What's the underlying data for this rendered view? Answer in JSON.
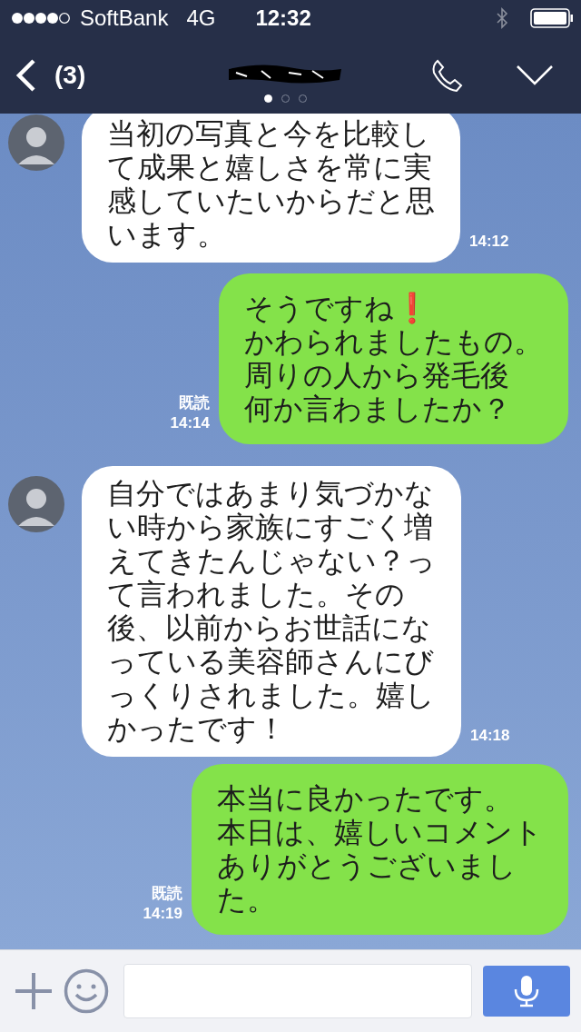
{
  "status_bar": {
    "carrier": "SoftBank",
    "network": "4G",
    "time": "12:32"
  },
  "nav": {
    "unread": "(3)",
    "pages": [
      {
        "selected": true
      },
      {
        "selected": false
      },
      {
        "selected": false
      }
    ]
  },
  "messages": [
    {
      "kind": "received",
      "lines": [
        "当初の写真と今を比較し",
        "て成果と嬉しさを常に実",
        "感していたいからだと思",
        "います。"
      ],
      "time": "14:12"
    },
    {
      "kind": "sent",
      "lines": [
        "そうですね❗",
        "かわられましたもの。",
        "周りの人から発毛後",
        "何か言わましたか？"
      ],
      "read_label": "既読",
      "time": "14:14"
    },
    {
      "kind": "received",
      "lines": [
        "自分ではあまり気づかな",
        "い時から家族にすごく増",
        "えてきたんじゃない？っ",
        "て言われました。その",
        "後、以前からお世話にな",
        "っている美容師さんにび",
        "っくりされました。嬉し",
        "かったです！"
      ],
      "time": "14:18"
    },
    {
      "kind": "sent",
      "lines": [
        "本当に良かったです。",
        "本日は、嬉しいコメント",
        "ありがとうございまし",
        "た。"
      ],
      "read_label": "既読",
      "time": "14:19"
    }
  ]
}
